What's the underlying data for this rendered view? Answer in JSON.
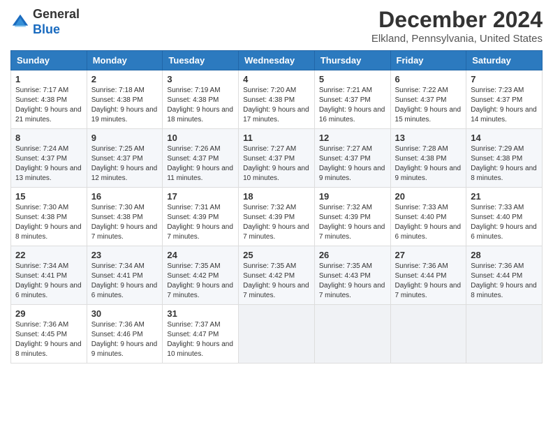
{
  "header": {
    "logo_general": "General",
    "logo_blue": "Blue",
    "month_title": "December 2024",
    "location": "Elkland, Pennsylvania, United States"
  },
  "weekdays": [
    "Sunday",
    "Monday",
    "Tuesday",
    "Wednesday",
    "Thursday",
    "Friday",
    "Saturday"
  ],
  "weeks": [
    [
      {
        "day": "1",
        "sunrise": "7:17 AM",
        "sunset": "4:38 PM",
        "daylight": "9 hours and 21 minutes"
      },
      {
        "day": "2",
        "sunrise": "7:18 AM",
        "sunset": "4:38 PM",
        "daylight": "9 hours and 19 minutes"
      },
      {
        "day": "3",
        "sunrise": "7:19 AM",
        "sunset": "4:38 PM",
        "daylight": "9 hours and 18 minutes"
      },
      {
        "day": "4",
        "sunrise": "7:20 AM",
        "sunset": "4:38 PM",
        "daylight": "9 hours and 17 minutes"
      },
      {
        "day": "5",
        "sunrise": "7:21 AM",
        "sunset": "4:37 PM",
        "daylight": "9 hours and 16 minutes"
      },
      {
        "day": "6",
        "sunrise": "7:22 AM",
        "sunset": "4:37 PM",
        "daylight": "9 hours and 15 minutes"
      },
      {
        "day": "7",
        "sunrise": "7:23 AM",
        "sunset": "4:37 PM",
        "daylight": "9 hours and 14 minutes"
      }
    ],
    [
      {
        "day": "8",
        "sunrise": "7:24 AM",
        "sunset": "4:37 PM",
        "daylight": "9 hours and 13 minutes"
      },
      {
        "day": "9",
        "sunrise": "7:25 AM",
        "sunset": "4:37 PM",
        "daylight": "9 hours and 12 minutes"
      },
      {
        "day": "10",
        "sunrise": "7:26 AM",
        "sunset": "4:37 PM",
        "daylight": "9 hours and 11 minutes"
      },
      {
        "day": "11",
        "sunrise": "7:27 AM",
        "sunset": "4:37 PM",
        "daylight": "9 hours and 10 minutes"
      },
      {
        "day": "12",
        "sunrise": "7:27 AM",
        "sunset": "4:37 PM",
        "daylight": "9 hours and 9 minutes"
      },
      {
        "day": "13",
        "sunrise": "7:28 AM",
        "sunset": "4:38 PM",
        "daylight": "9 hours and 9 minutes"
      },
      {
        "day": "14",
        "sunrise": "7:29 AM",
        "sunset": "4:38 PM",
        "daylight": "9 hours and 8 minutes"
      }
    ],
    [
      {
        "day": "15",
        "sunrise": "7:30 AM",
        "sunset": "4:38 PM",
        "daylight": "9 hours and 8 minutes"
      },
      {
        "day": "16",
        "sunrise": "7:30 AM",
        "sunset": "4:38 PM",
        "daylight": "9 hours and 7 minutes"
      },
      {
        "day": "17",
        "sunrise": "7:31 AM",
        "sunset": "4:39 PM",
        "daylight": "9 hours and 7 minutes"
      },
      {
        "day": "18",
        "sunrise": "7:32 AM",
        "sunset": "4:39 PM",
        "daylight": "9 hours and 7 minutes"
      },
      {
        "day": "19",
        "sunrise": "7:32 AM",
        "sunset": "4:39 PM",
        "daylight": "9 hours and 7 minutes"
      },
      {
        "day": "20",
        "sunrise": "7:33 AM",
        "sunset": "4:40 PM",
        "daylight": "9 hours and 6 minutes"
      },
      {
        "day": "21",
        "sunrise": "7:33 AM",
        "sunset": "4:40 PM",
        "daylight": "9 hours and 6 minutes"
      }
    ],
    [
      {
        "day": "22",
        "sunrise": "7:34 AM",
        "sunset": "4:41 PM",
        "daylight": "9 hours and 6 minutes"
      },
      {
        "day": "23",
        "sunrise": "7:34 AM",
        "sunset": "4:41 PM",
        "daylight": "9 hours and 6 minutes"
      },
      {
        "day": "24",
        "sunrise": "7:35 AM",
        "sunset": "4:42 PM",
        "daylight": "9 hours and 7 minutes"
      },
      {
        "day": "25",
        "sunrise": "7:35 AM",
        "sunset": "4:42 PM",
        "daylight": "9 hours and 7 minutes"
      },
      {
        "day": "26",
        "sunrise": "7:35 AM",
        "sunset": "4:43 PM",
        "daylight": "9 hours and 7 minutes"
      },
      {
        "day": "27",
        "sunrise": "7:36 AM",
        "sunset": "4:44 PM",
        "daylight": "9 hours and 7 minutes"
      },
      {
        "day": "28",
        "sunrise": "7:36 AM",
        "sunset": "4:44 PM",
        "daylight": "9 hours and 8 minutes"
      }
    ],
    [
      {
        "day": "29",
        "sunrise": "7:36 AM",
        "sunset": "4:45 PM",
        "daylight": "9 hours and 8 minutes"
      },
      {
        "day": "30",
        "sunrise": "7:36 AM",
        "sunset": "4:46 PM",
        "daylight": "9 hours and 9 minutes"
      },
      {
        "day": "31",
        "sunrise": "7:37 AM",
        "sunset": "4:47 PM",
        "daylight": "9 hours and 10 minutes"
      },
      null,
      null,
      null,
      null
    ]
  ],
  "labels": {
    "sunrise": "Sunrise:",
    "sunset": "Sunset:",
    "daylight": "Daylight:"
  }
}
